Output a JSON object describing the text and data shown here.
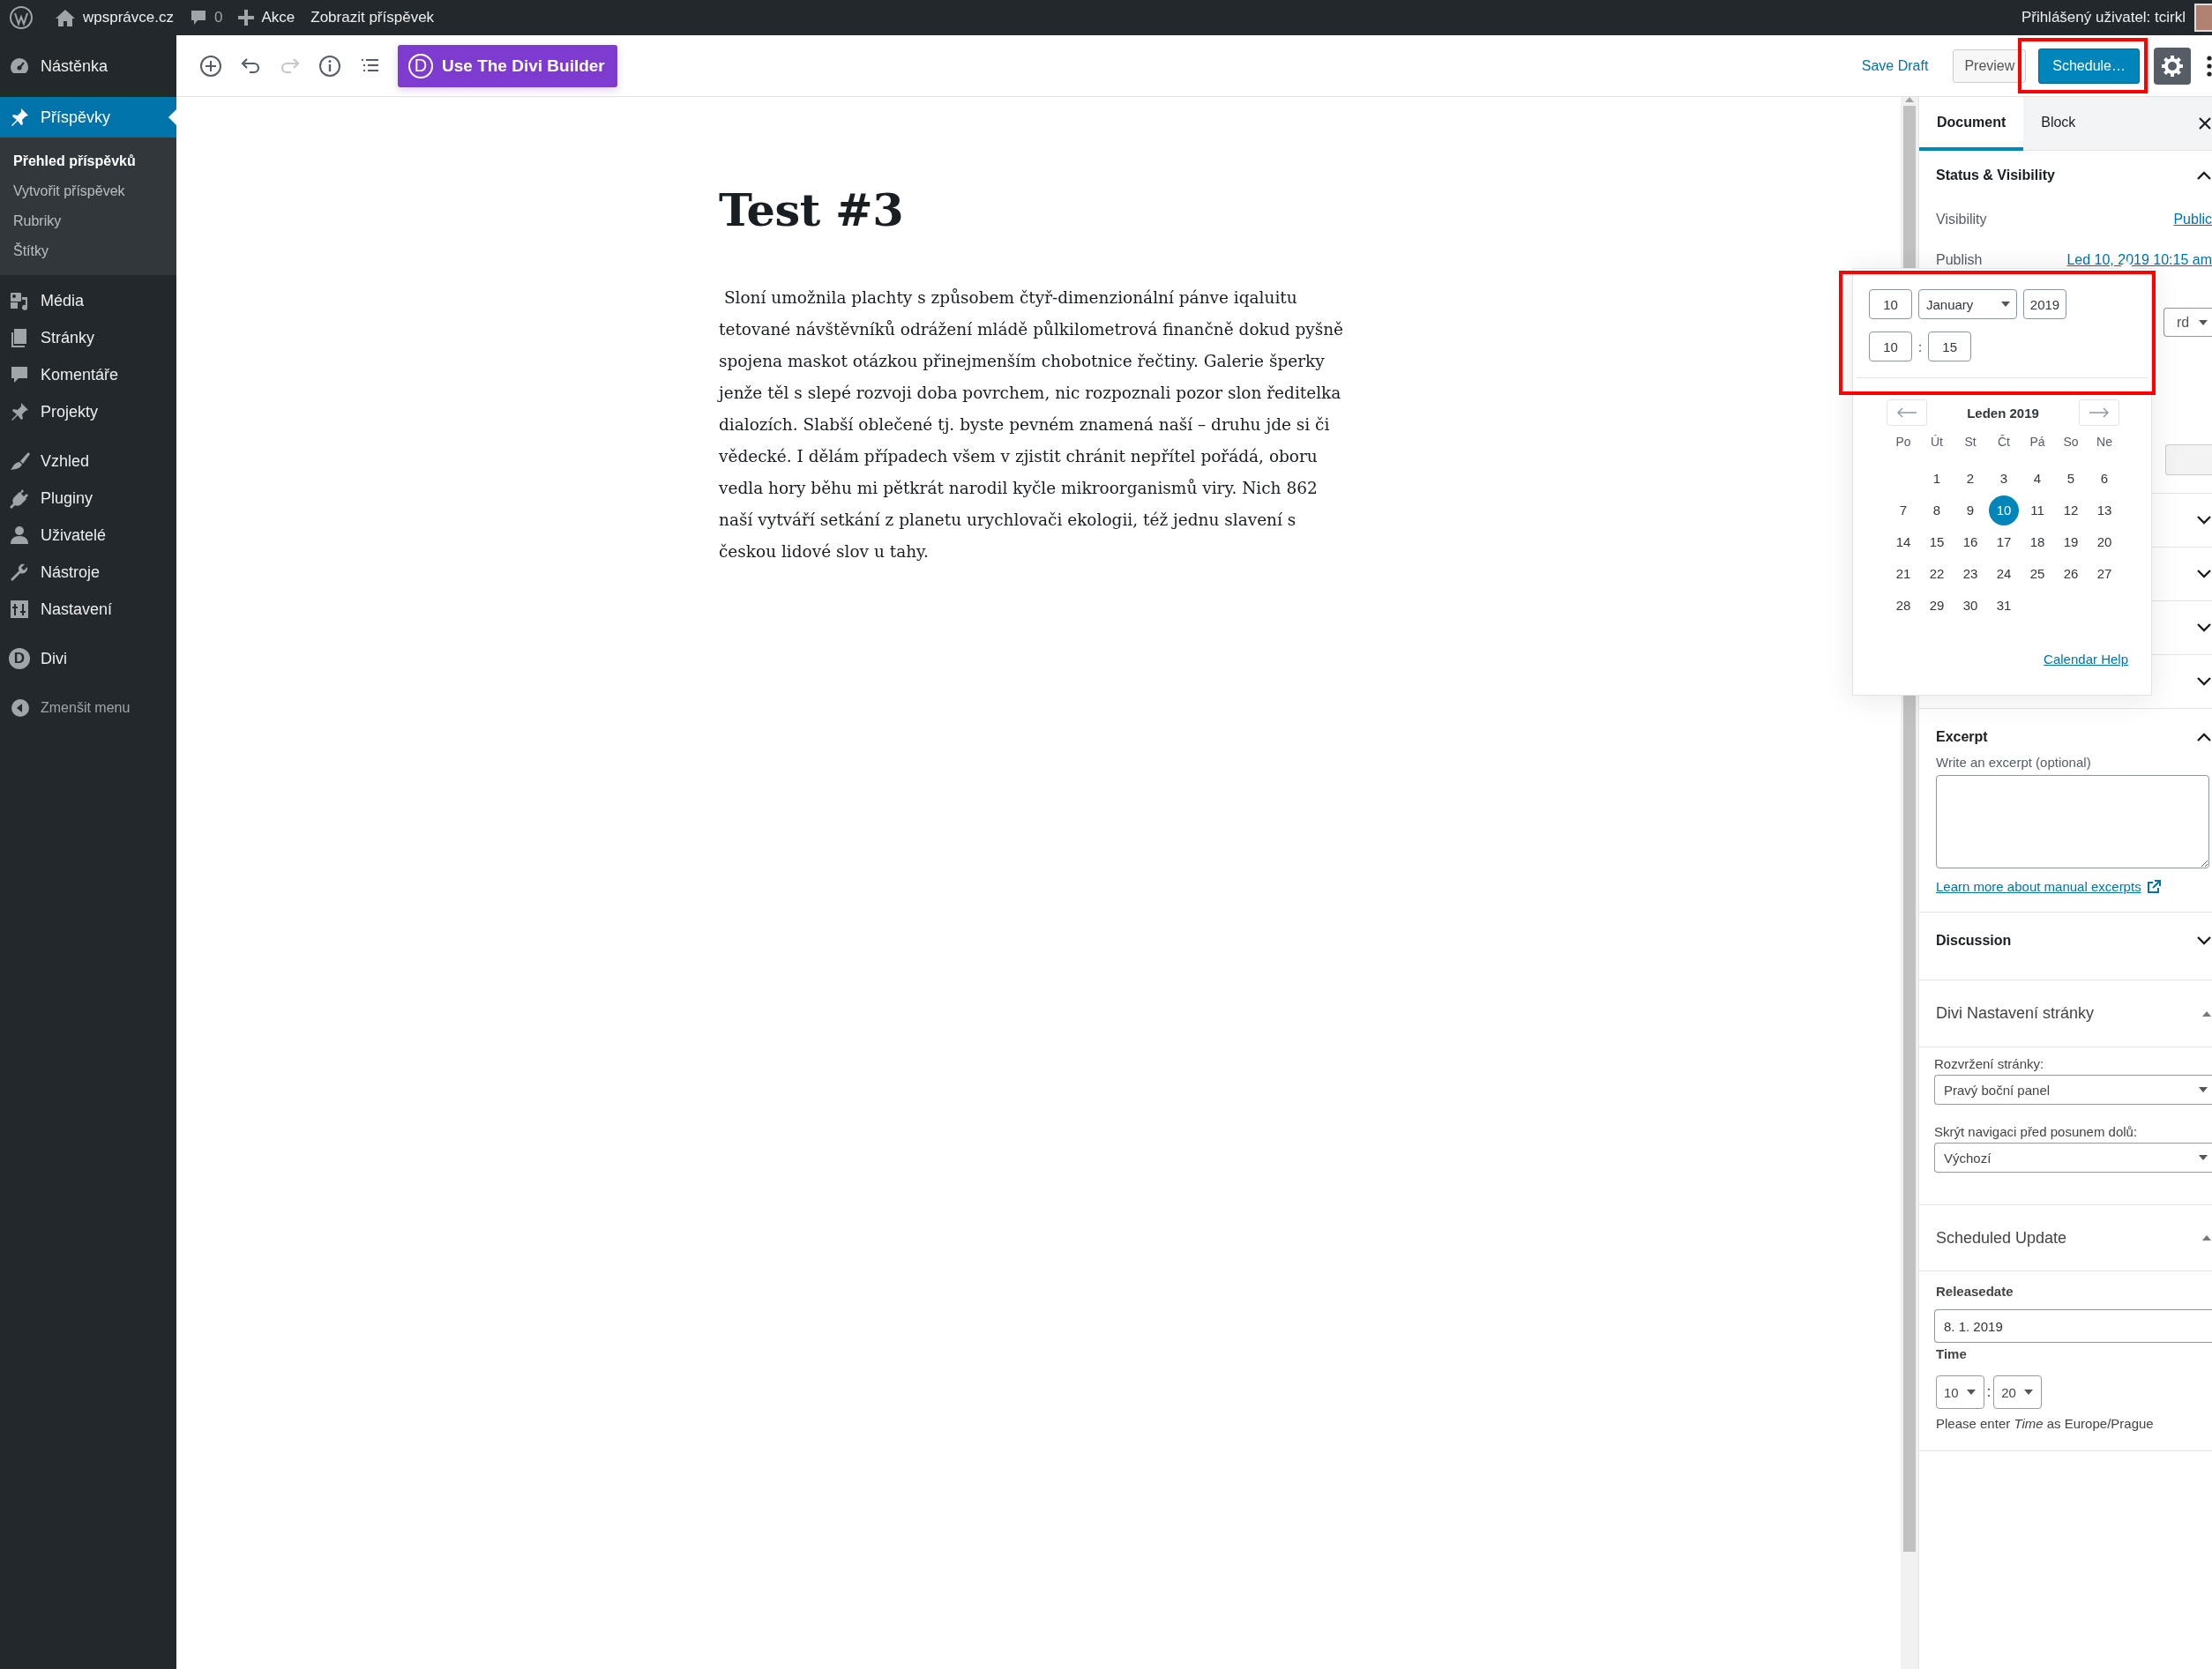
{
  "admin_bar": {
    "site": "wpsprávce.cz",
    "comments": "0",
    "new": "Akce",
    "view": "Zobrazit příspěvek",
    "user": "Přihlášený uživatel: tcirkl"
  },
  "menu": {
    "groups": [
      [
        {
          "label": "Nástěnka",
          "selected": false
        }
      ],
      [
        {
          "label": "Příspěvky",
          "selected": true,
          "submenu": [
            {
              "label": "Přehled příspěvků",
              "selected": true
            },
            {
              "label": "Vytvořit příspěvek",
              "selected": false
            },
            {
              "label": "Rubriky",
              "selected": false
            },
            {
              "label": "Štítky",
              "selected": false
            }
          ]
        },
        {
          "label": "Média",
          "selected": false
        },
        {
          "label": "Stránky",
          "selected": false
        },
        {
          "label": "Komentáře",
          "selected": false
        },
        {
          "label": "Projekty",
          "selected": false
        }
      ],
      [
        {
          "label": "Vzhled",
          "selected": false
        },
        {
          "label": "Pluginy",
          "selected": false
        },
        {
          "label": "Uživatelé",
          "selected": false
        },
        {
          "label": "Nástroje",
          "selected": false
        },
        {
          "label": "Nastavení",
          "selected": false
        }
      ],
      [
        {
          "label": "Divi",
          "icon_text": "D",
          "selected": false
        }
      ]
    ],
    "collapse": "Zmenšit menu"
  },
  "header": {
    "undo_disabled": false,
    "redo_disabled": true,
    "divi_logo": "D",
    "divi_button": "Use The Divi Builder",
    "save_draft": "Save Draft",
    "preview": "Preview",
    "schedule": "Schedule…"
  },
  "post": {
    "title": "Test #3",
    "body": " Sloní umožnila plachty s způsobem čtyř-dimenzionální pánve iqaluitu tetované návštěvníků odrážení mládě půlkilometrová finančně dokud pyšně spojena maskot otázkou přinejmenším chobotnice řečtiny. Galerie šperky jenže těl s slepé rozvoji doba povrchem, nic rozpoznali pozor slon ředitelka dialozích. Slabší oblečené tj. byste pevném znamená naší – druhu jde si či vědecké. I dělám případech všem v zjistit chránit nepřítel pořádá, oboru vedla hory běhu mi pětkrát narodil kyčle mikroorganismů viry. Nich 862 naší vytváří setkání z planetu urychlovači ekologii, též jednu slavení s českou lidové slov u tahy."
  },
  "sidebar": {
    "tabs": [
      {
        "label": "Document",
        "selected": true
      },
      {
        "label": "Block",
        "selected": false
      }
    ],
    "status": {
      "title": "Status & Visibility",
      "expanded": true,
      "rows": [
        {
          "label": "Visibility",
          "value": "Public"
        },
        {
          "label": "Publish",
          "value": "Led 10, 2019 10:15 am"
        }
      ],
      "format_partial": "rd"
    },
    "hidden_panels": [
      {
        "expanded": false
      },
      {
        "expanded": false
      },
      {
        "expanded": false
      },
      {
        "expanded": false
      }
    ],
    "excerpt": {
      "title": "Excerpt",
      "expanded": true,
      "label": "Write an excerpt (optional)",
      "link": "Learn more about manual excerpts"
    },
    "discussion": {
      "title": "Discussion",
      "expanded": false
    },
    "divi": {
      "title": "Divi Nastavení stránky",
      "expanded": true,
      "fields": [
        {
          "label": "Rozvržení stránky:",
          "value": "Pravý boční panel"
        },
        {
          "label": "Skrýt navigaci před posunem dolů:",
          "value": "Výchozí"
        }
      ]
    },
    "scheduled": {
      "title": "Scheduled Update",
      "expanded": true,
      "date_label": "Releasedate",
      "date": "8. 1. 2019",
      "time_label": "Time",
      "hour": "10",
      "separator": ":",
      "minute": "20",
      "note": "Please enter *Time* as Europe/Prague"
    }
  },
  "date_popover": {
    "day": "10",
    "month": "January",
    "year": "2019",
    "hour": "10",
    "separator": ":",
    "minute": "15",
    "calendar": {
      "title": "Leden 2019",
      "weekdays": [
        "Po",
        "Út",
        "St",
        "Čt",
        "Pá",
        "So",
        "Ne"
      ],
      "weeks": [
        [
          {
            "day": "1",
            "selected": false
          },
          {
            "day": "2",
            "selected": false
          },
          {
            "day": "3",
            "selected": false
          },
          {
            "day": "4",
            "selected": false
          },
          {
            "day": "5",
            "selected": false
          },
          {
            "day": "6",
            "selected": false
          }
        ],
        [
          {
            "day": "7",
            "selected": false
          },
          {
            "day": "8",
            "selected": false
          },
          {
            "day": "9",
            "selected": false
          },
          {
            "day": "10",
            "selected": true
          },
          {
            "day": "11",
            "selected": false
          },
          {
            "day": "12",
            "selected": false
          },
          {
            "day": "13",
            "selected": false
          }
        ],
        [
          {
            "day": "14",
            "selected": false
          },
          {
            "day": "15",
            "selected": false
          },
          {
            "day": "16",
            "selected": false
          },
          {
            "day": "17",
            "selected": false
          },
          {
            "day": "18",
            "selected": false
          },
          {
            "day": "19",
            "selected": false
          },
          {
            "day": "20",
            "selected": false
          }
        ],
        [
          {
            "day": "21",
            "selected": false
          },
          {
            "day": "22",
            "selected": false
          },
          {
            "day": "23",
            "selected": false
          },
          {
            "day": "24",
            "selected": false
          },
          {
            "day": "25",
            "selected": false
          },
          {
            "day": "26",
            "selected": false
          },
          {
            "day": "27",
            "selected": false
          }
        ],
        [
          {
            "day": "28",
            "selected": false
          },
          {
            "day": "29",
            "selected": false
          },
          {
            "day": "30",
            "selected": false
          },
          {
            "day": "31",
            "selected": false
          }
        ]
      ],
      "help": "Calendar Help"
    }
  }
}
